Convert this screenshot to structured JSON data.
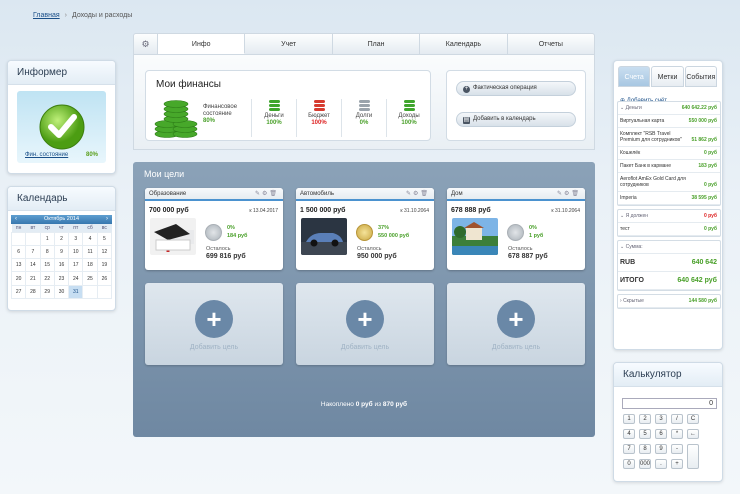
{
  "breadcrumb": {
    "home": "Главная",
    "current": "Доходы и расходы"
  },
  "tabs": [
    "Инфо",
    "Учет",
    "План",
    "Календарь",
    "Отчеты"
  ],
  "informer": {
    "title": "Информер",
    "link": "Фин. состояние",
    "pct": "80%"
  },
  "calendar": {
    "title": "Календарь",
    "month": "Октябрь 2014",
    "weekdays": [
      "пн",
      "вт",
      "ср",
      "чт",
      "пт",
      "сб",
      "вс"
    ],
    "weeks": [
      [
        "",
        "",
        "1",
        "2",
        "3",
        "4",
        "5"
      ],
      [
        "6",
        "7",
        "8",
        "9",
        "10",
        "11",
        "12"
      ],
      [
        "13",
        "14",
        "15",
        "16",
        "17",
        "18",
        "19"
      ],
      [
        "20",
        "21",
        "22",
        "23",
        "24",
        "25",
        "26"
      ],
      [
        "27",
        "28",
        "29",
        "30",
        "31",
        "",
        ""
      ]
    ],
    "today": "31"
  },
  "finances": {
    "title": "Мои финансы",
    "state_label_1": "Финансовое",
    "state_label_2": "состояние",
    "state_value": "80%",
    "metrics": [
      {
        "label": "Деньги",
        "value": "100%",
        "color": "#3fa52c"
      },
      {
        "label": "Бюджет",
        "value": "100%",
        "color": "#d63b2f"
      },
      {
        "label": "Долги",
        "value": "0%",
        "color": "#9aa3ab"
      },
      {
        "label": "Доходы",
        "value": "100%",
        "color": "#3fa52c"
      }
    ]
  },
  "actions": {
    "op": "Фактическая операция",
    "add": "Добавить в календарь"
  },
  "goals": {
    "title": "Мои цели",
    "remaining_label": "Осталось",
    "cards": [
      {
        "name": "Образование",
        "amount": "700 000 руб",
        "date": "к 13.04.2017",
        "pct": "0%",
        "saved": "184 руб",
        "left": "699 816 руб",
        "gold": false
      },
      {
        "name": "Автомобиль",
        "amount": "1 500 000 руб",
        "date": "к 31.10.2064",
        "pct": "37%",
        "saved": "550 000 руб",
        "left": "950 000 руб",
        "gold": true
      },
      {
        "name": "Дом",
        "amount": "678 888 руб",
        "date": "к 31.10.2064",
        "pct": "0%",
        "saved": "1 руб",
        "left": "678 887 руб",
        "gold": false
      }
    ],
    "add_label": "Добавить цель",
    "saved_prefix": "Накоплено",
    "saved_amount": "0 руб",
    "saved_mid": "из",
    "saved_total": "870 руб"
  },
  "accounts": {
    "tabs": [
      "Счета",
      "Метки",
      "События"
    ],
    "add": "Добавить счёт",
    "money_group": "Деньги",
    "money_total": "640 642.22 руб",
    "items": [
      {
        "name": "Виртуальная карта",
        "value": "550 000 руб"
      },
      {
        "name": "Комплект \"RSB Travel Premium для сотрудников\"",
        "value": "51 862 руб"
      },
      {
        "name": "Кошелёк",
        "value": "0 руб"
      },
      {
        "name": "Пакет Банк в кармане",
        "value": "183 руб"
      },
      {
        "name": "Aeroflot AmEx Gold Card для сотрудников",
        "value": "0 руб"
      },
      {
        "name": "Imperia",
        "value": "38 595 руб"
      }
    ],
    "owe_group": "Я должен",
    "owe_value": "0 руб",
    "test_name": "тест",
    "test_value": "0 руб",
    "sum_group": "Сумма:",
    "rub_label": "RUB",
    "rub_value": "640 642",
    "total_label": "ИТОГО",
    "total_value": "640 642 руб",
    "hidden_label": "Скрытые",
    "hidden_value": "144 580 руб"
  },
  "calculator": {
    "title": "Калькулятор",
    "display": "0",
    "keys": [
      "1",
      "2",
      "3",
      "/",
      "C",
      "4",
      "5",
      "6",
      "*",
      "←",
      "7",
      "8",
      "9",
      "-",
      "",
      "0",
      "000",
      ".",
      "+",
      ""
    ]
  }
}
